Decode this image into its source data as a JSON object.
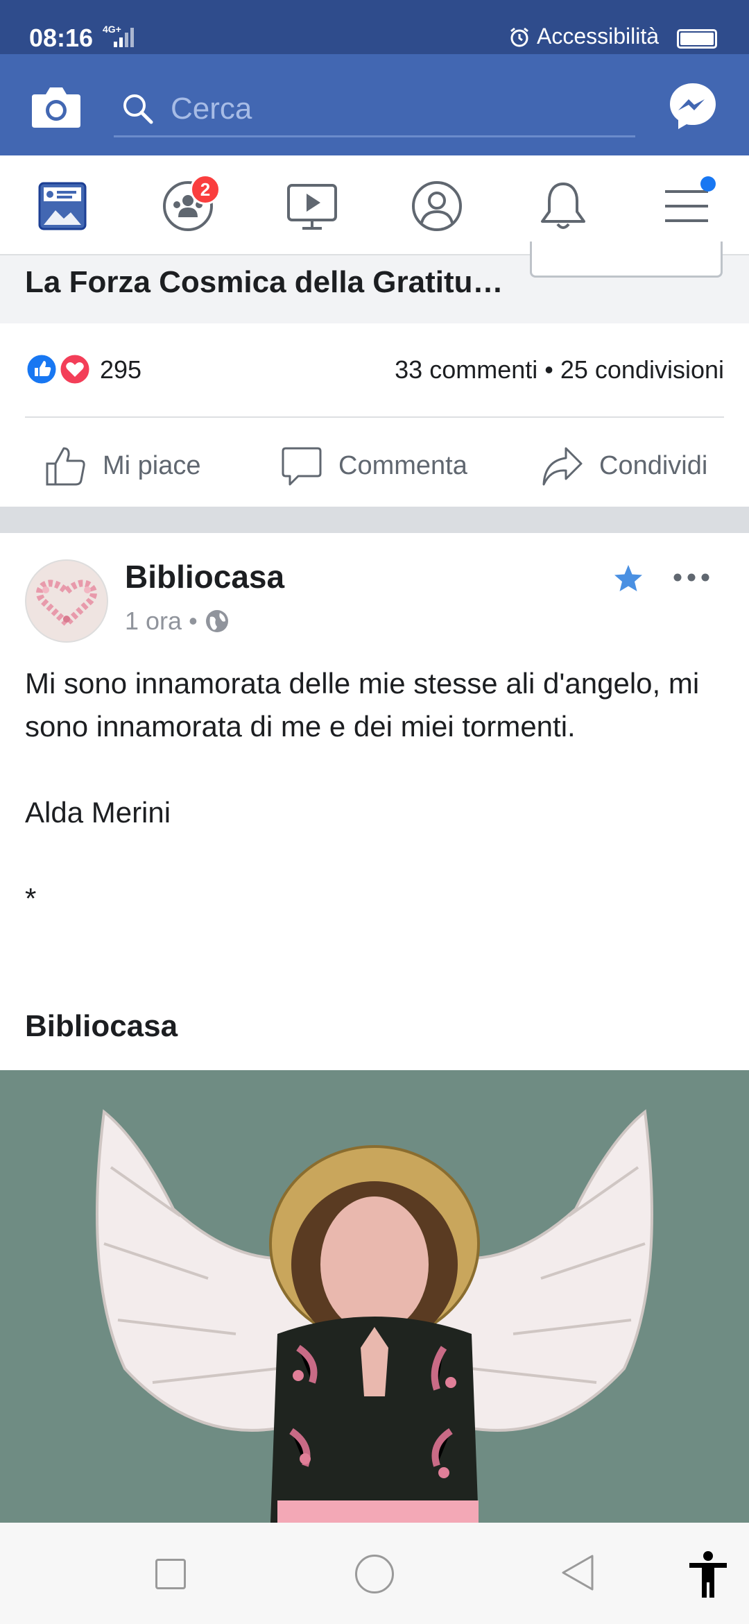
{
  "status": {
    "time": "08:16",
    "network": "4G+",
    "accessibility_label": "Accessibilità"
  },
  "header": {
    "search_placeholder": "Cerca"
  },
  "tabs": {
    "groups_badge": "2"
  },
  "previous_post": {
    "title": "La Forza Cosmica della Gratitu…",
    "reaction_count": "295",
    "stats": "33 commenti • 25 condivisioni",
    "actions": {
      "like": "Mi piace",
      "comment": "Commenta",
      "share": "Condividi"
    }
  },
  "post": {
    "author": "Bibliocasa",
    "time": "1 ora",
    "separator": "•",
    "lines": [
      "Mi sono innamorata delle mie stesse ali d'angelo, mi sono innamorata di me e dei miei tormenti.",
      "",
      "Alda Merini",
      "",
      "*"
    ],
    "signature": "Bibliocasa"
  },
  "colors": {
    "status_bar": "#2f4c8c",
    "header": "#4267b2",
    "accent": "#1877f2",
    "badge": "#fa3e3e",
    "love": "#f33e58"
  }
}
